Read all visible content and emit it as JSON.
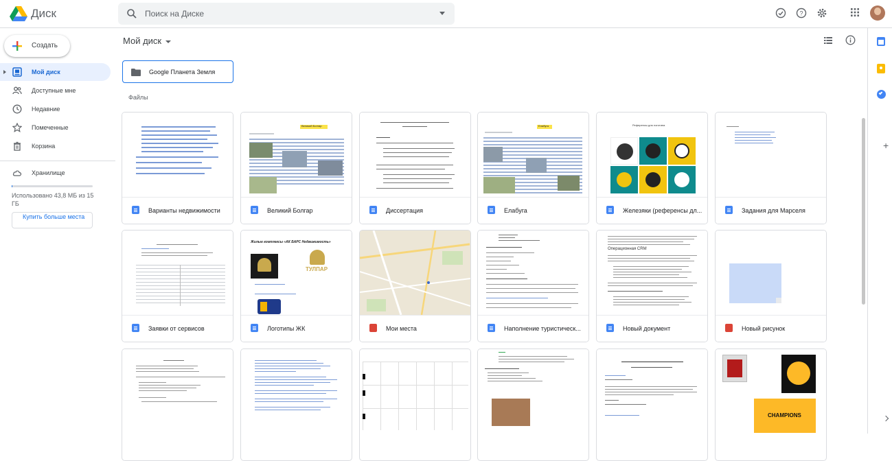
{
  "app": {
    "title": "Диск"
  },
  "search": {
    "placeholder": "Поиск на Диске"
  },
  "header_icons": [
    "check-circle-icon",
    "help-icon",
    "settings-icon",
    "apps-grid-icon",
    "avatar"
  ],
  "sidebar": {
    "create_label": "Создать",
    "items": [
      {
        "label": "Мой диск",
        "icon": "my-drive-icon",
        "active": true
      },
      {
        "label": "Доступные мне",
        "icon": "shared-people-icon",
        "active": false
      },
      {
        "label": "Недавние",
        "icon": "clock-icon",
        "active": false
      },
      {
        "label": "Помеченные",
        "icon": "star-icon",
        "active": false
      },
      {
        "label": "Корзина",
        "icon": "trash-icon",
        "active": false
      }
    ],
    "storage": {
      "label": "Хранилище",
      "usage_text": "Использовано 43,8 МБ из 15 ГБ",
      "used_fraction": 0.003,
      "buy_label": "Купить больше места"
    }
  },
  "main": {
    "breadcrumb": "Мой диск",
    "folders": [
      {
        "name": "Google Планета Земля"
      }
    ],
    "files_heading": "Файлы",
    "files": [
      {
        "name": "Варианты недвижимости",
        "type": "doc"
      },
      {
        "name": "Великий Болгар",
        "type": "doc"
      },
      {
        "name": "Диссертация",
        "type": "doc"
      },
      {
        "name": "Елабуга",
        "type": "doc"
      },
      {
        "name": "Железяки (референсы дл...",
        "type": "doc"
      },
      {
        "name": "Задания для Марселя",
        "type": "doc"
      },
      {
        "name": "Заявки от сервисов",
        "type": "doc"
      },
      {
        "name": "Логотипы ЖК",
        "type": "doc"
      },
      {
        "name": "Мои места",
        "type": "map"
      },
      {
        "name": "Наполнение туристическ...",
        "type": "doc"
      },
      {
        "name": "Новый документ",
        "type": "doc"
      },
      {
        "name": "Новый рисунок",
        "type": "drawing"
      }
    ]
  },
  "thumbs": {
    "bolgar_title": "Великий Болгар",
    "elabuga_title": "Елабуга",
    "refs_title": "Референсы для логотипа",
    "logos_title": "Жилые комплексы «АК БАРС Недвижимость»",
    "tulpar_text": "ТУЛПАР",
    "crm_title": "Операционная CRM",
    "champions_text": "CHAMPIONS"
  },
  "colors": {
    "accent": "#1a73e8",
    "active_bg": "#e8f0fe",
    "doc_blue": "#4285f4",
    "red": "#db4437"
  }
}
